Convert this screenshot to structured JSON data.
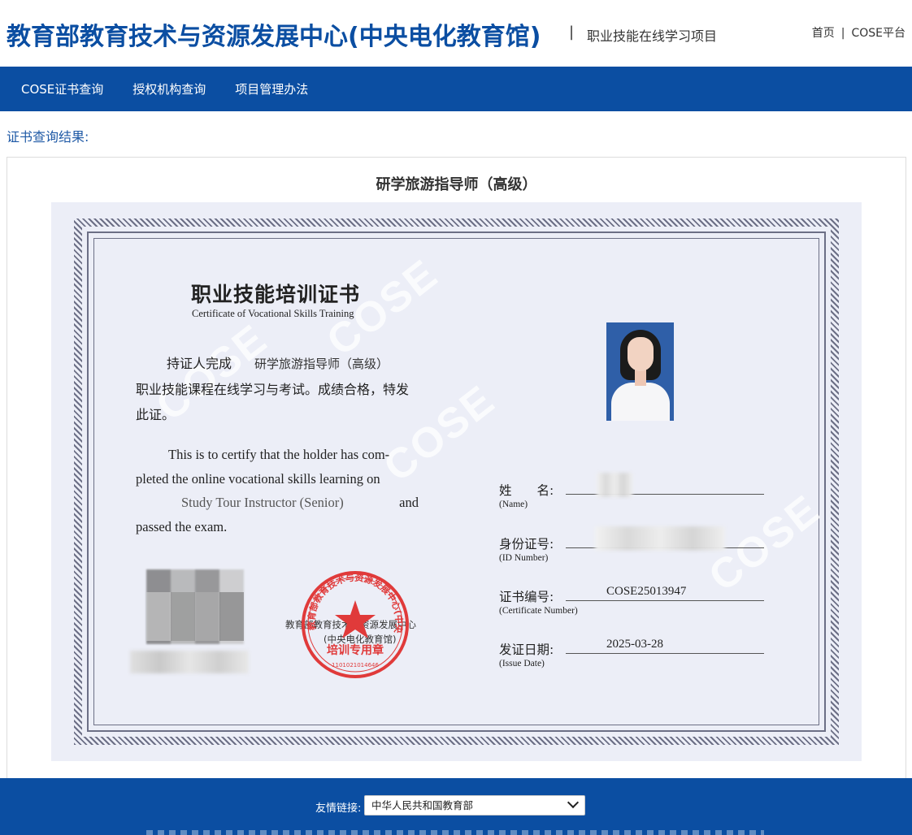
{
  "header": {
    "org_title": "教育部教育技术与资源发展中心(中央电化教育馆)",
    "separator": "|",
    "project_name": "职业技能在线学习项目",
    "links": [
      {
        "label": "首页"
      },
      {
        "label": "COSE平台"
      }
    ],
    "link_separator": "|"
  },
  "nav": {
    "items": [
      {
        "label": "COSE证书查询"
      },
      {
        "label": "授权机构查询"
      },
      {
        "label": "项目管理办法"
      }
    ]
  },
  "result": {
    "label": "证书查询结果:",
    "panel_title": "研学旅游指导师（高级）"
  },
  "certificate": {
    "title_cn": "职业技能培训证书",
    "title_en": "Certificate of Vocational Skills Training",
    "cn_holder_prefix": "持证人完成",
    "cn_course": "研学旅游指导师（高级）",
    "cn_line2": "职业技能课程在线学习与考试。成绩合格，特发",
    "cn_line3": "此证。",
    "en_line1_a": "This is to certify that the holder has com-",
    "en_line2": "pleted the online vocational skills learning on",
    "en_course": "Study Tour Instructor (Senior)",
    "en_and": "and",
    "en_line4": "passed the exam.",
    "watermark": "COSE",
    "seal": {
      "ring_text": "教育部教育技术与资源发展中心(中央电化教育馆)",
      "center_text": "培训专用章",
      "number": "1101021014646",
      "color": "#e03a3a"
    },
    "seal_caption_1": "教育部教育技术与资源发展中心",
    "seal_caption_2": "(中央电化教育馆)",
    "fields": {
      "name_label": "姓　　名:",
      "name_label_en": "(Name)",
      "id_label": "身份证号:",
      "id_label_en": "(ID Number)",
      "cert_no_label": "证书编号:",
      "cert_no_label_en": "(Certificate Number)",
      "cert_no_value": "COSE25013947",
      "issue_date_label": "发证日期:",
      "issue_date_label_en": "(Issue Date)",
      "issue_date_value": "2025-03-28"
    }
  },
  "footer": {
    "links_label": "友情链接:",
    "links_selected": "中华人民共和国教育部"
  },
  "colors": {
    "brand_blue": "#0b4ea2",
    "cert_background": "#eceef7",
    "seal_red": "#e03a3a"
  }
}
